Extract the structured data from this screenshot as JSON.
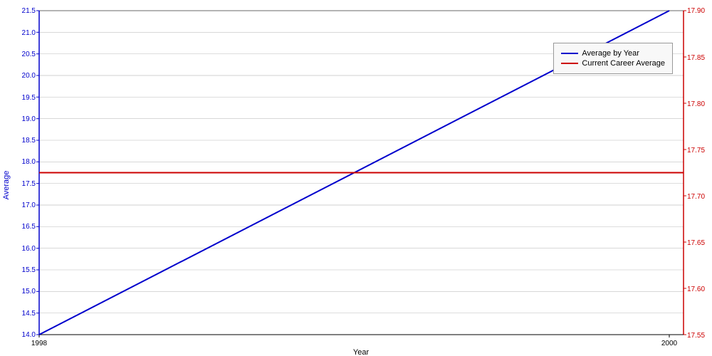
{
  "chart": {
    "title": "",
    "xAxis": {
      "label": "Year",
      "min": 1998,
      "max": 2000,
      "ticks": [
        1998,
        2000
      ]
    },
    "yAxisLeft": {
      "label": "Average",
      "min": 14.0,
      "max": 21.5,
      "ticks": [
        14.0,
        14.5,
        15.0,
        15.5,
        16.0,
        16.5,
        17.0,
        17.5,
        18.0,
        18.5,
        19.0,
        19.5,
        20.0,
        20.5,
        21.0,
        21.5
      ]
    },
    "yAxisRight": {
      "label": "",
      "min": 17.55,
      "max": 17.9,
      "ticks": [
        17.55,
        17.6,
        17.65,
        17.7,
        17.75,
        17.8,
        17.85,
        17.9
      ]
    },
    "series": [
      {
        "name": "Average by Year",
        "color": "#0000cc",
        "type": "line",
        "start": [
          1998,
          14.0
        ],
        "end": [
          2000,
          21.5
        ]
      },
      {
        "name": "Current Career Average",
        "color": "#cc0000",
        "type": "line",
        "value": 17.75
      }
    ]
  },
  "legend": {
    "items": [
      {
        "label": "Average by Year",
        "color": "#0000cc"
      },
      {
        "label": "Current Career Average",
        "color": "#cc0000"
      }
    ]
  }
}
